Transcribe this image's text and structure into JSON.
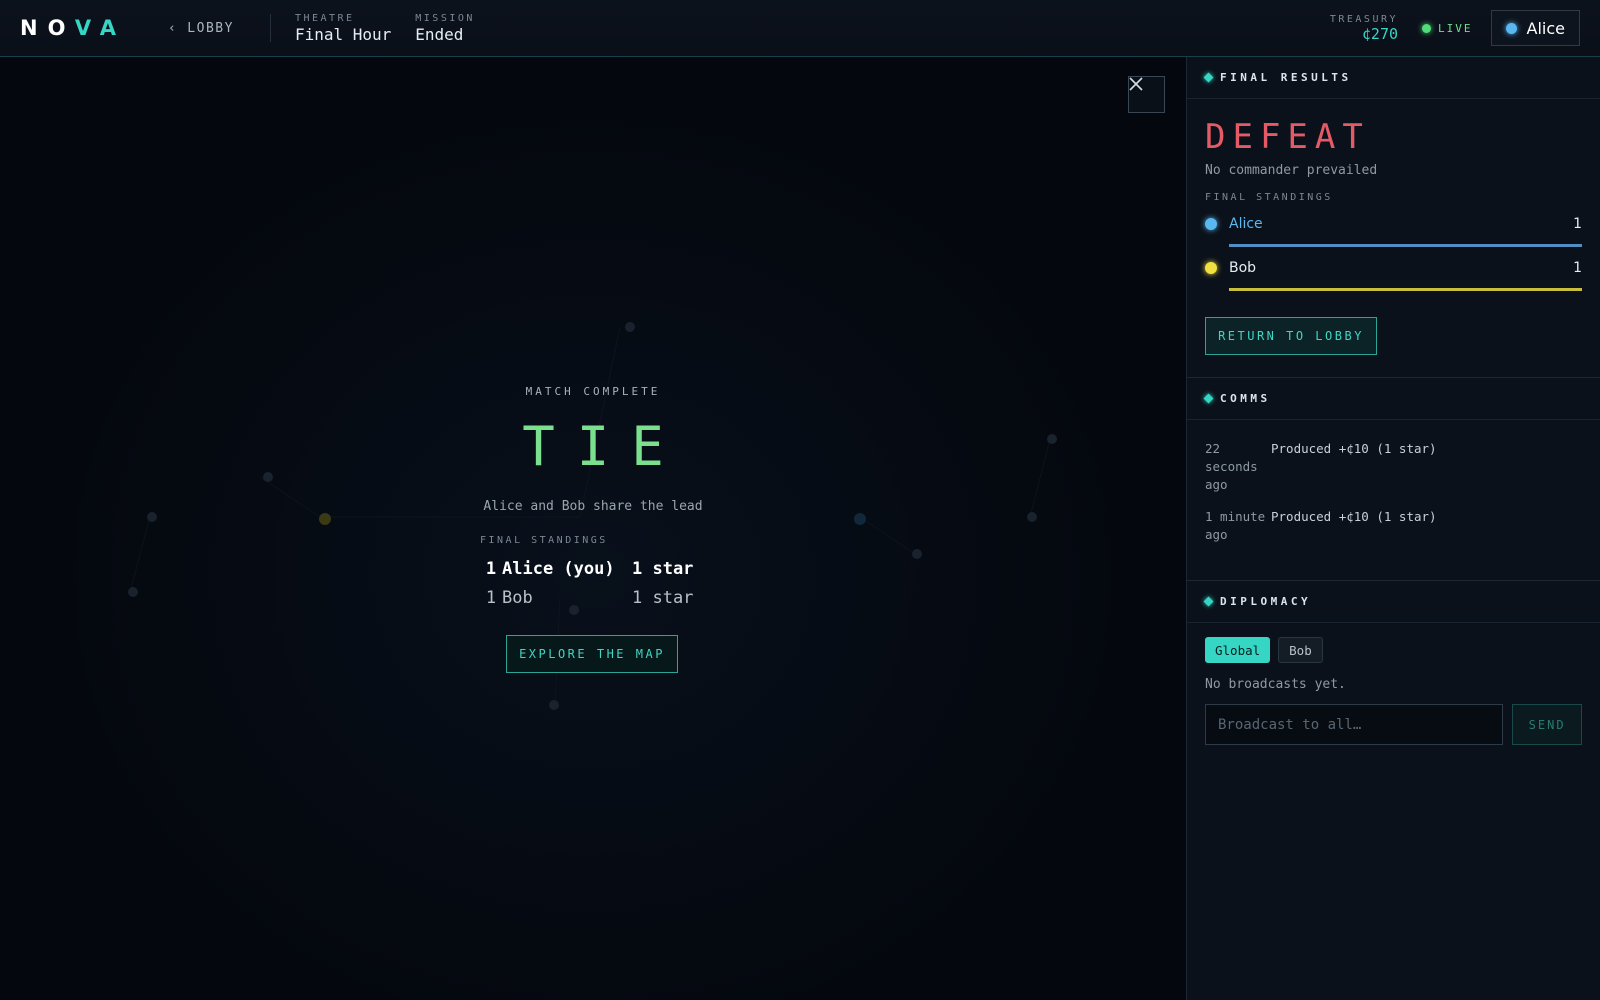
{
  "header": {
    "logo_left": "NO",
    "logo_right": "VA",
    "lobby_chevron": "‹",
    "lobby_label": "LOBBY",
    "theatre_label": "THEATRE",
    "theatre_value": "Final Hour",
    "mission_label": "MISSION",
    "mission_value": "Ended",
    "treasury_label": "TREASURY",
    "treasury_value": "¢270",
    "live_label": "LIVE",
    "user_name": "Alice"
  },
  "overlay": {
    "match_label": "MATCH COMPLETE",
    "title": "TIE",
    "subtitle": "Alice and Bob share the lead",
    "standings_label": "FINAL STANDINGS",
    "standings": [
      {
        "rank": "1",
        "name": "Alice (you)",
        "score": "1 star"
      },
      {
        "rank": "1",
        "name": "Bob",
        "score": "1 star"
      }
    ],
    "explore_label": "EXPLORE THE MAP"
  },
  "results": {
    "heading": "FINAL RESULTS",
    "outcome": "DEFEAT",
    "outcome_sub": "No commander prevailed",
    "standings_label": "FINAL STANDINGS",
    "players": [
      {
        "name": "Alice",
        "score": "1",
        "color": "#5ab8f0",
        "bar_color": "#4f8fc4",
        "share": 1.0
      },
      {
        "name": "Bob",
        "score": "1",
        "color": "#f0e040",
        "bar_color": "#c8bd3c",
        "share": 1.0
      }
    ],
    "return_label": "RETURN TO LOBBY"
  },
  "comms": {
    "heading": "COMMS",
    "items": [
      {
        "time": "22 seconds ago",
        "message": "Produced +¢10 (1 star)"
      },
      {
        "time": "1 minute ago",
        "message": "Produced +¢10 (1 star)"
      }
    ]
  },
  "diplomacy": {
    "heading": "DIPLOMACY",
    "tabs": [
      "Global",
      "Bob"
    ],
    "empty_text": "No broadcasts yet.",
    "input_placeholder": "Broadcast to all…",
    "send_label": "SEND"
  },
  "colors": {
    "accent": "#35d6c4",
    "tie_green": "#7be08d",
    "defeat_red": "#e45b67",
    "alice_blue": "#5ab8f0",
    "bob_yellow": "#f0e040"
  }
}
